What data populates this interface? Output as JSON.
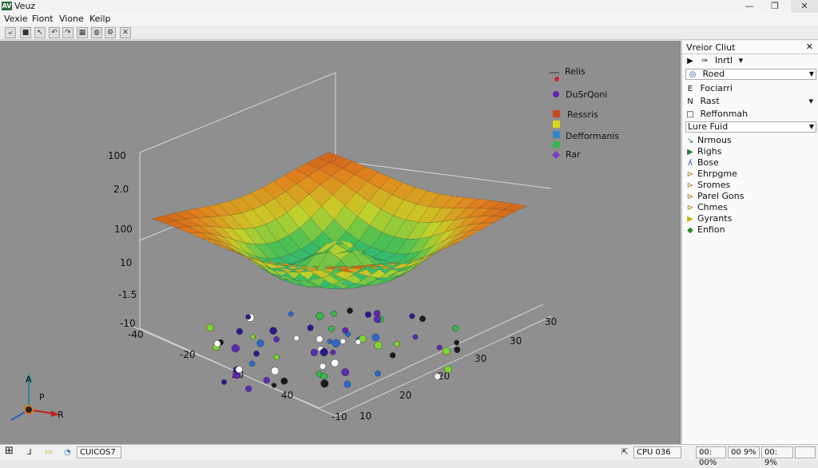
{
  "window": {
    "app_icon_text": "AV",
    "title": "Veuz",
    "minimize_glyph": "—",
    "maximize_glyph": "❐",
    "close_glyph": "✕"
  },
  "menu": {
    "items": [
      "Vexie",
      "Fiont",
      "Vione",
      "Keilp"
    ]
  },
  "toolbar": {
    "buttons": [
      "open-icon",
      "save-icon",
      "cursor-icon",
      "undo-icon",
      "redo-icon",
      "chart-icon",
      "globe-icon",
      "settings-icon",
      "close-icon"
    ],
    "glyphs": [
      "⤶",
      "■",
      "↖",
      "↶",
      "↷",
      "▦",
      "◍",
      "⚙",
      "✕"
    ]
  },
  "plot": {
    "z_ticks": [
      "100",
      "2.0",
      "100",
      "10",
      "-1.5",
      "-10"
    ],
    "x_ticks": [
      "-40",
      "-20",
      "20",
      "40",
      "-10"
    ],
    "y_ticks": [
      "10",
      "20",
      "20",
      "30",
      "30"
    ],
    "legend": [
      {
        "label": "Relis",
        "color": "#d32424",
        "marker": "dash-dot"
      },
      {
        "label": "DuSrQoni",
        "color": "#6a1fb0",
        "marker": "dot"
      },
      {
        "label": "Ressris",
        "color": "#c8461e",
        "marker": "square"
      },
      {
        "label": "Defformanis",
        "color": "#d8d81e",
        "marker": "square"
      },
      {
        "label": "Rar",
        "color": "#7b3ac6",
        "marker": "diamond"
      }
    ],
    "gizmo": {
      "up": "A",
      "right": "R",
      "side": "P"
    }
  },
  "panel": {
    "title": "Vreior Cliut",
    "close_glyph": "✕",
    "tool_label": "Inrtl",
    "selected_field": "Roed",
    "rows_a": [
      {
        "icon": "E",
        "label": "Fociarri"
      },
      {
        "icon": "N",
        "label": "Rast"
      },
      {
        "icon": "□",
        "label": "Reffonmah"
      }
    ],
    "dropdown2": "Lure Fuid",
    "rows_b": [
      {
        "icon": "↘",
        "label": "Nrmous",
        "color": "#2a7a3a"
      },
      {
        "icon": "▶",
        "label": "Righs",
        "color": "#2a7a3a"
      },
      {
        "icon": "ʎ",
        "label": "Bose",
        "color": "#1f4fa0"
      },
      {
        "icon": "⊳",
        "label": "Ehrpgme",
        "color": "#a07a10"
      },
      {
        "icon": "⊳",
        "label": "Sromes",
        "color": "#a07a10"
      },
      {
        "icon": "⊳",
        "label": "Parel Gons",
        "color": "#a07a10"
      },
      {
        "icon": "⊳",
        "label": "Chmes",
        "color": "#a07a10"
      },
      {
        "icon": "▶",
        "label": "Gyrants",
        "color": "#c8b018"
      },
      {
        "icon": "◆",
        "label": "Enfion",
        "color": "#2a8a2a"
      }
    ]
  },
  "taskbar": {
    "start_glyph": "⊞",
    "items": [
      "⅃",
      "▭",
      "◔"
    ],
    "app_label": "CUICOS7",
    "status": [
      "CPU 036",
      "00: 00%",
      "00 9%",
      "00: 9%"
    ]
  }
}
